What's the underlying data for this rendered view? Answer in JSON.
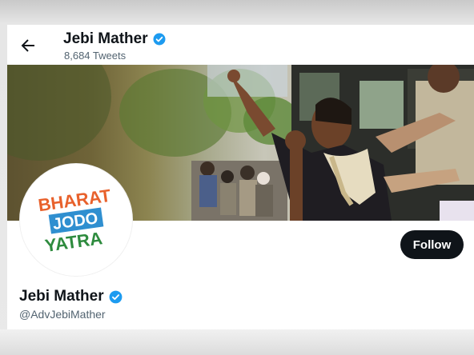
{
  "header": {
    "name": "Jebi Mather",
    "tweet_count": "8,684 Tweets",
    "back_icon": "arrow-left-icon",
    "verified_icon": "verified-badge-icon"
  },
  "banner": {
    "description_icon": "protest-photo"
  },
  "avatar": {
    "logo_line1": "BHARAT",
    "logo_line2": "JODO",
    "logo_line3": "YATRA",
    "colors": {
      "bharat": "#e8612c",
      "jodo_bg": "#2f8fd0",
      "yatra": "#2e8b3e"
    }
  },
  "profile": {
    "name": "Jebi Mather",
    "handle": "@AdvJebiMather",
    "follow_label": "Follow"
  },
  "colors": {
    "text_primary": "#0f1419",
    "text_secondary": "#536471",
    "verified_blue": "#1d9bf0",
    "follow_bg": "#0f1419"
  }
}
